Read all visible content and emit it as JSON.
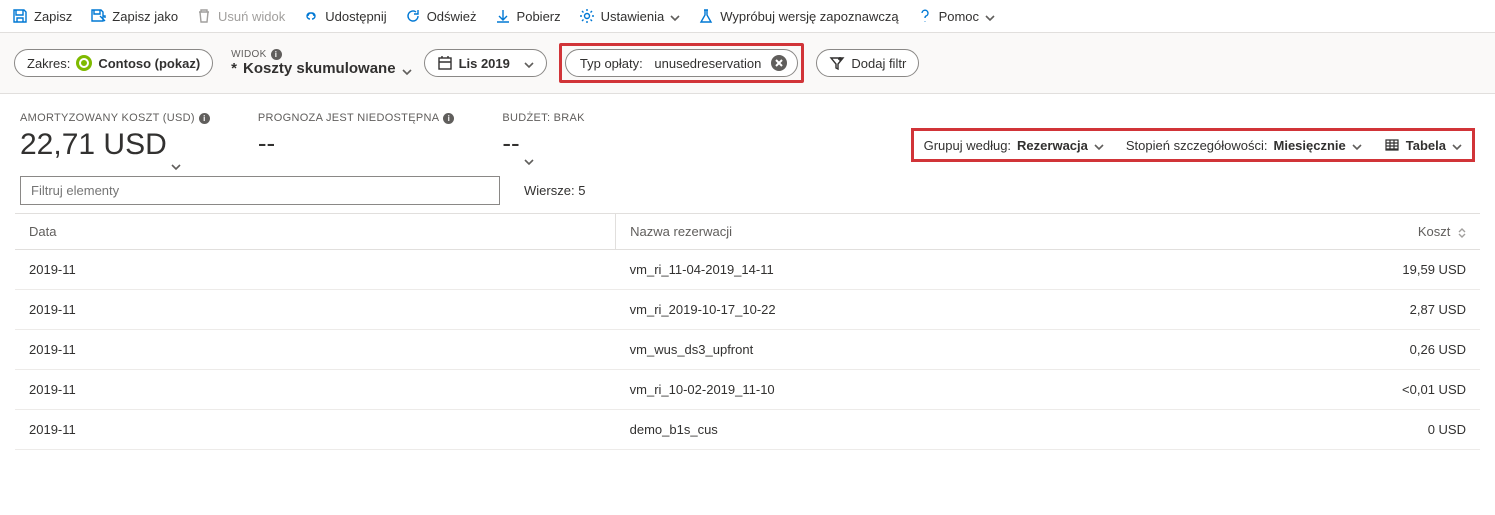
{
  "toolbar": {
    "save": "Zapisz",
    "save_as": "Zapisz jako",
    "delete_view": "Usuń widok",
    "share": "Udostępnij",
    "refresh": "Odśwież",
    "download": "Pobierz",
    "settings": "Ustawienia",
    "try_preview": "Wypróbuj wersję zapoznawczą",
    "help": "Pomoc"
  },
  "scope": {
    "label": "Zakres:",
    "value": "Contoso (pokaz)"
  },
  "view": {
    "label": "WIDOK",
    "value": "Koszty skumulowane",
    "prefix": "* "
  },
  "date": {
    "value": "Lis 2019"
  },
  "filter_chip": {
    "label": "Typ opłaty:",
    "value": "unusedreservation"
  },
  "add_filter": "Dodaj filtr",
  "summary": {
    "cost_label": "AMORTYZOWANY KOSZT (USD)",
    "cost_value": "22,71 USD",
    "forecast_label": "PROGNOZA JEST NIEDOSTĘPNA",
    "forecast_value": "--",
    "budget_label": "BUDŻET: BRAK",
    "budget_value": "--"
  },
  "view_controls": {
    "group_label": "Grupuj według:",
    "group_value": "Rezerwacja",
    "granularity_label": "Stopień szczegółowości:",
    "granularity_value": "Miesięcznie",
    "display_value": "Tabela"
  },
  "filter_input_placeholder": "Filtruj elementy",
  "rows_label": "Wiersze:",
  "rows_count": "5",
  "table": {
    "headers": {
      "date": "Data",
      "name": "Nazwa rezerwacji",
      "cost": "Koszt"
    },
    "rows": [
      {
        "date": "2019-11",
        "name": "vm_ri_11-04-2019_14-11",
        "cost": "19,59 USD"
      },
      {
        "date": "2019-11",
        "name": "vm_ri_2019-10-17_10-22",
        "cost": "2,87 USD"
      },
      {
        "date": "2019-11",
        "name": "vm_wus_ds3_upfront",
        "cost": "0,26 USD"
      },
      {
        "date": "2019-11",
        "name": "vm_ri_10-02-2019_11-10",
        "cost": "<0,01 USD"
      },
      {
        "date": "2019-11",
        "name": "demo_b1s_cus",
        "cost": "0 USD"
      }
    ]
  }
}
